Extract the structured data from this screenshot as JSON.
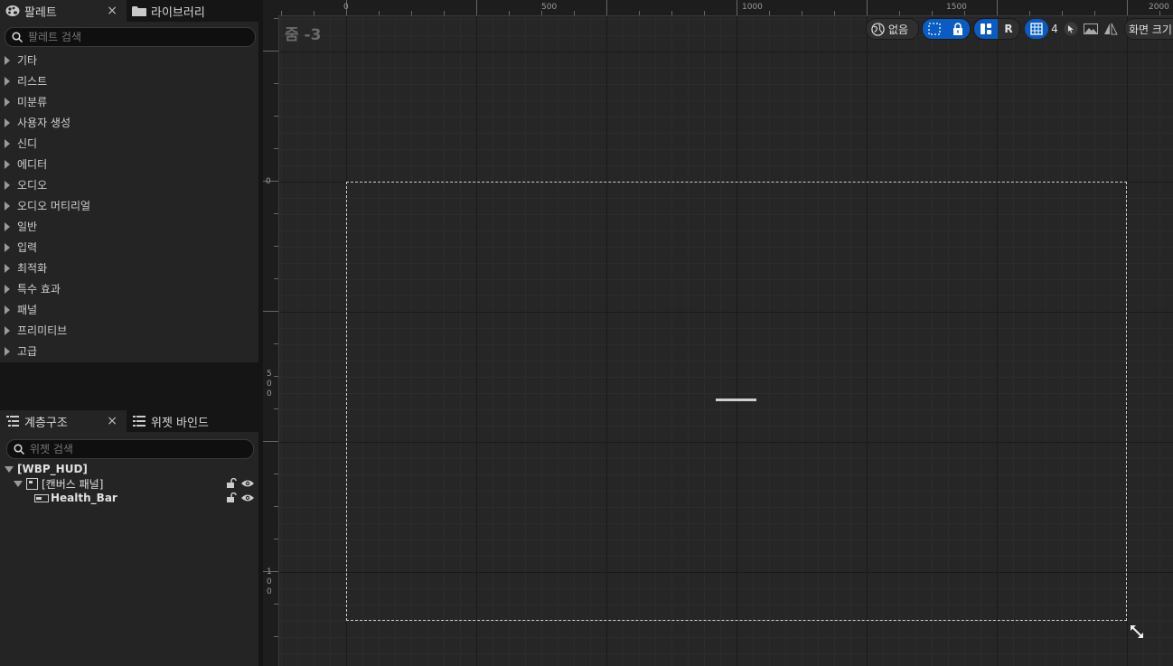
{
  "palette": {
    "tab_label": "팔레트",
    "library_tab_label": "라이브러리",
    "close_glyph": "×",
    "search_placeholder": "팔레트 검색",
    "categories": [
      "기타",
      "리스트",
      "미분류",
      "사용자 생성",
      "신디",
      "에디터",
      "오디오",
      "오디오 머티리얼",
      "일반",
      "입력",
      "최적화",
      "특수 효과",
      "패널",
      "프리미티브",
      "고급"
    ]
  },
  "hierarchy": {
    "tab_label": "계층구조",
    "binding_tab_label": "위젯 바인드",
    "close_glyph": "×",
    "search_placeholder": "위젯 검색",
    "root": "[WBP_HUD]",
    "canvas_panel": "[캔버스 패널]",
    "health_bar": "Health_Bar"
  },
  "designer": {
    "zoom_label": "줌 -3",
    "world_space_label": "없음",
    "r_label": "R",
    "grid_snap_value": "4",
    "screen_size_label": "화면 크기",
    "ruler_h": [
      "0",
      "500",
      "1000",
      "1500",
      "2000"
    ],
    "ruler_v": [
      [
        "0"
      ],
      [
        "5",
        "0",
        "0"
      ],
      [
        "1",
        "0",
        "0"
      ]
    ]
  },
  "colors": {
    "accent": "#0a5cc4",
    "panel": "#242424",
    "canvas": "#262626"
  }
}
